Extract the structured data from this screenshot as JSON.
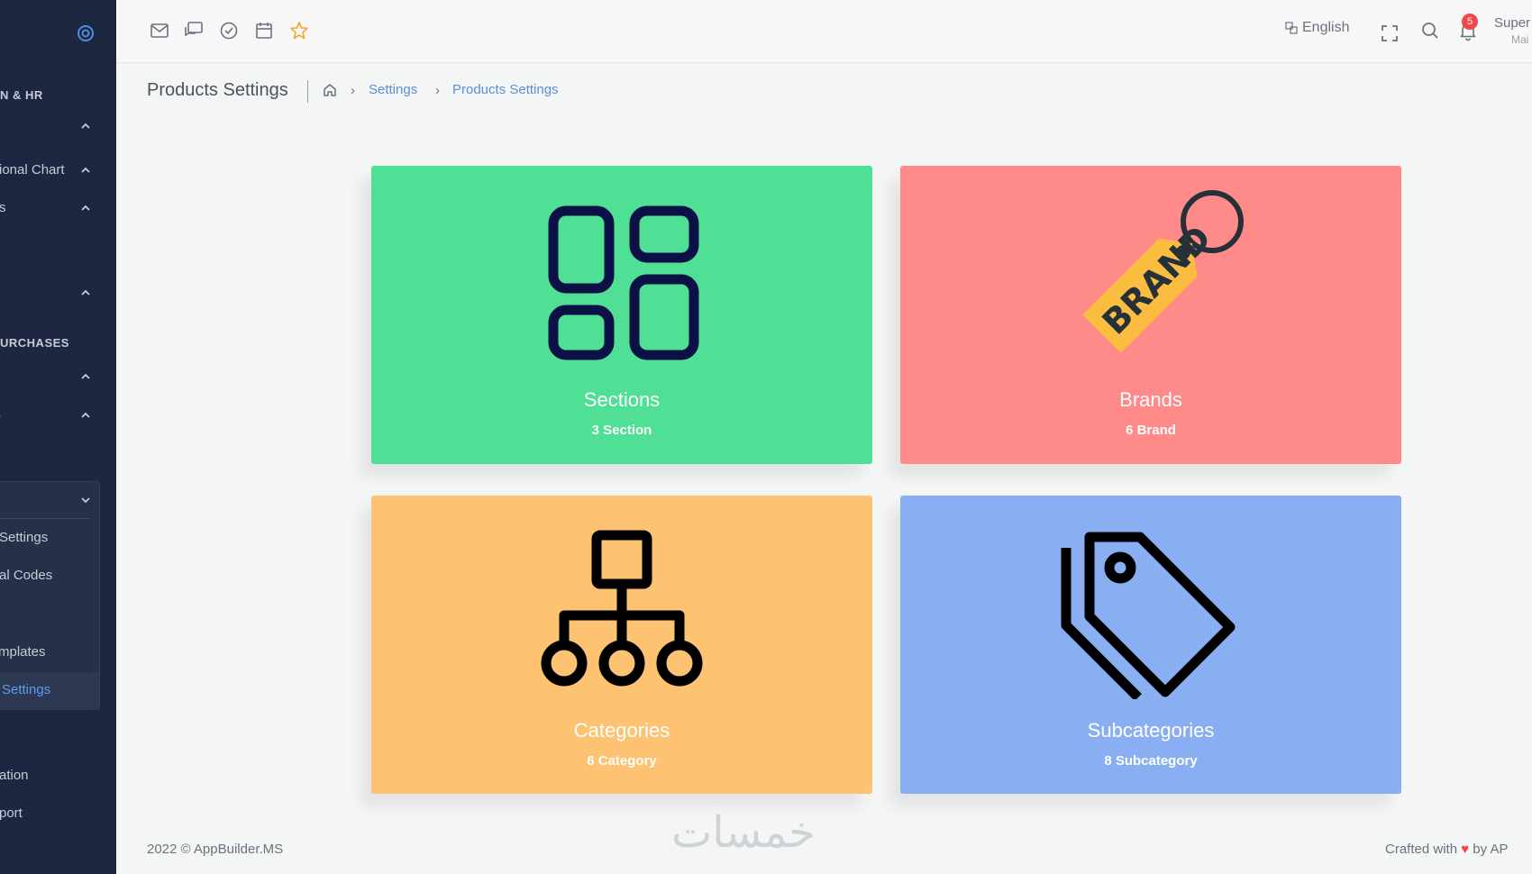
{
  "sidebar": {
    "headings": [
      "N & HR",
      "URCHASES"
    ],
    "items": [
      "ional Chart",
      "s",
      "Settings",
      "al Codes",
      "mplates",
      "Settings",
      "ation",
      "port"
    ],
    "dash": "-"
  },
  "topbar": {
    "language": "English",
    "notification_count": "5",
    "user_name": "Super",
    "user_role": "Mai"
  },
  "breadcrumb": {
    "page_title": "Products Settings",
    "separator": "›",
    "items": [
      "Settings",
      "Products Settings"
    ]
  },
  "cards": [
    {
      "title": "Sections",
      "count": "3 Section",
      "color": "#4fdf95"
    },
    {
      "title": "Brands",
      "count": "6 Brand",
      "color": "#ff8a8a",
      "logo_text": "BRAND"
    },
    {
      "title": "Categories",
      "count": "6 Category",
      "color": "#fdc272"
    },
    {
      "title": "Subcategories",
      "count": "8 Subcategory",
      "color": "#8aaef2"
    }
  ],
  "footer": {
    "copyright": "2022 © AppBuilder.MS",
    "crafted_prefix": "Crafted with",
    "crafted_suffix": "by",
    "crafted_brand": "AP"
  },
  "watermark": "خمسات"
}
